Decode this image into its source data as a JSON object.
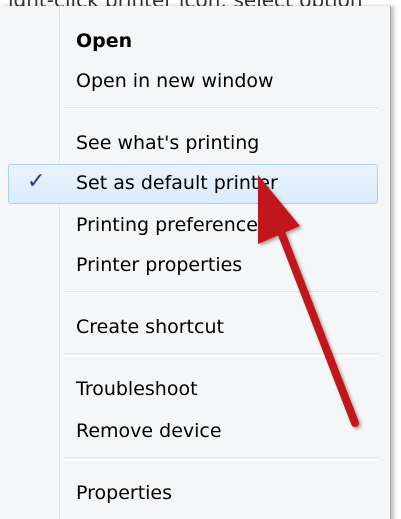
{
  "top_partial_text": "ight-click printer icon; select option",
  "menu": {
    "items": [
      {
        "label": "Open",
        "bold": true
      },
      {
        "label": "Open in new window"
      },
      {
        "label": "See what's printing"
      },
      {
        "label": "Set as default printer",
        "checked": true,
        "highlighted": true
      },
      {
        "label": "Printing preferences"
      },
      {
        "label": "Printer properties"
      },
      {
        "label": "Create shortcut"
      },
      {
        "label": "Troubleshoot"
      },
      {
        "label": "Remove device"
      },
      {
        "label": "Properties"
      }
    ],
    "check_glyph": "✓"
  },
  "colors": {
    "highlight_border": "#a8d0f5",
    "arrow": "#c0171c"
  }
}
